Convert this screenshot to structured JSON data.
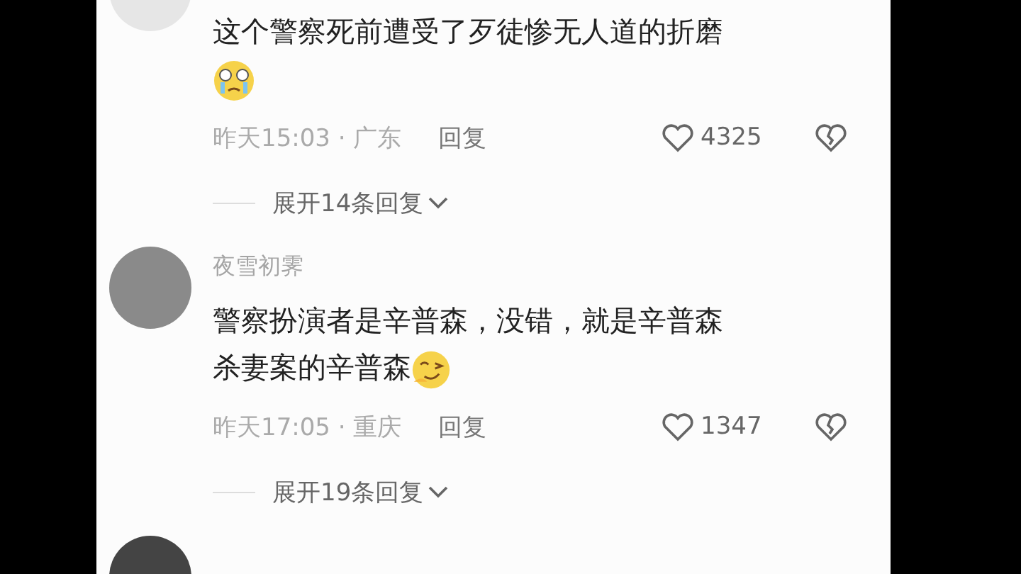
{
  "comments": [
    {
      "text": "这个警察死前遭受了歹徒惨无人道的折磨",
      "kind": "crying",
      "meta": "昨天15:03 · 广东",
      "reply": "回复",
      "likes": "4325",
      "expand": "展开14条回复"
    },
    {
      "name": "夜雪初霁",
      "text": "警察扮演者是辛普森，没错，就是辛普森杀妻案的辛普森",
      "kind": "smirk",
      "meta": "昨天17:05 · 重庆",
      "reply": "回复",
      "likes": "1347",
      "expand": "展开19条回复"
    }
  ],
  "next_comment_visible": true
}
